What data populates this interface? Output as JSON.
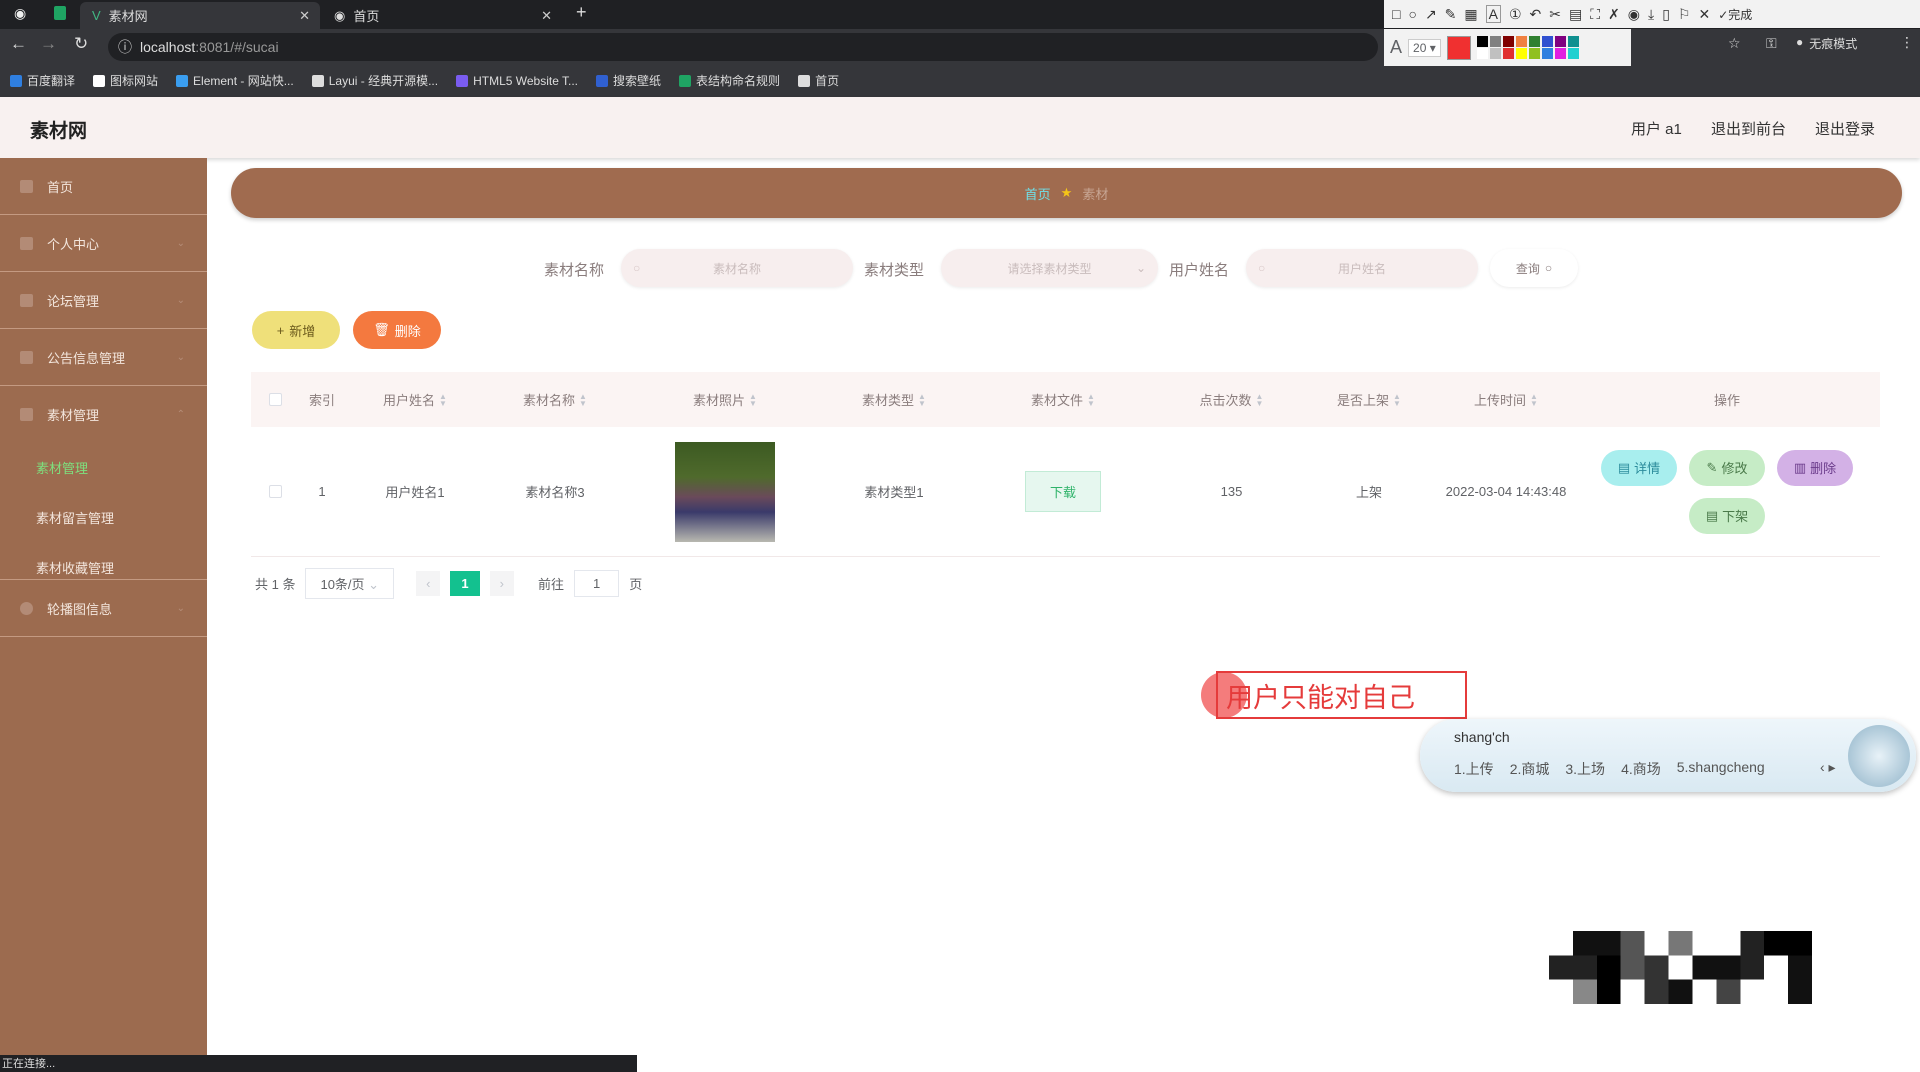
{
  "browser": {
    "tabs": [
      {
        "title": "素材网",
        "active": true
      },
      {
        "title": "首页",
        "active": false
      }
    ],
    "url_host": "localhost",
    "url_rest": ":8081/#/sucai",
    "incognito_label": "无痕模式",
    "status_text": "正在连接...",
    "bookmarks": [
      "百度翻译",
      "图标网站",
      "Element - 网站快...",
      "Layui - 经典开源模...",
      "HTML5 Website T...",
      "搜索壁纸",
      "表结构命名规则",
      "首页"
    ]
  },
  "snip_tool": {
    "done_label": "完成",
    "font_size": "20",
    "colors": [
      "#000000",
      "#808080",
      "#800000",
      "#f08040",
      "#308030",
      "#3050d0",
      "#800080",
      "#109090",
      "#ffffff",
      "#c0c0c0",
      "#e03030",
      "#ffff00",
      "#90c020",
      "#3080e0",
      "#e020e0",
      "#20d0d0"
    ],
    "current_color": "#f03030"
  },
  "header": {
    "title": "素材网",
    "user": "用户 a1",
    "to_front": "退出到前台",
    "logout": "退出登录"
  },
  "sidebar": {
    "items": [
      {
        "label": "首页"
      },
      {
        "label": "个人中心"
      },
      {
        "label": "论坛管理"
      },
      {
        "label": "公告信息管理"
      },
      {
        "label": "素材管理"
      },
      {
        "label": "轮播图信息"
      }
    ],
    "sub": [
      {
        "label": "素材管理",
        "active": true
      },
      {
        "label": "素材留言管理"
      },
      {
        "label": "素材收藏管理"
      }
    ]
  },
  "breadcrumb": {
    "home": "首页",
    "current": "素材"
  },
  "search": {
    "name_label": "素材名称",
    "name_placeholder": "素材名称",
    "type_label": "素材类型",
    "type_placeholder": "请选择素材类型",
    "user_label": "用户姓名",
    "user_placeholder": "用户姓名",
    "query": "查询"
  },
  "actions": {
    "add": "新增",
    "delete": "删除"
  },
  "table": {
    "headers": [
      "索引",
      "用户姓名",
      "素材名称",
      "素材照片",
      "素材类型",
      "素材文件",
      "点击次数",
      "是否上架",
      "上传时间",
      "操作"
    ],
    "rows": [
      {
        "index": "1",
        "user": "用户姓名1",
        "name": "素材名称3",
        "type": "素材类型1",
        "file": "下载",
        "clicks": "135",
        "on_shelf": "上架",
        "time": "2022-03-04 14:43:48",
        "ops": {
          "detail": "详情",
          "edit": "修改",
          "delete": "删除",
          "offshelf": "下架"
        }
      }
    ]
  },
  "pager": {
    "total": "共 1 条",
    "size": "10条/页",
    "current": "1",
    "goto": "前往",
    "goto_value": "1",
    "page_suffix": "页"
  },
  "annotation": {
    "text": "用户只能对自己"
  },
  "ime": {
    "input": "shang'ch",
    "candidates": [
      "1.上传",
      "2.商城",
      "3.上场",
      "4.商场",
      "5.shangcheng"
    ]
  }
}
